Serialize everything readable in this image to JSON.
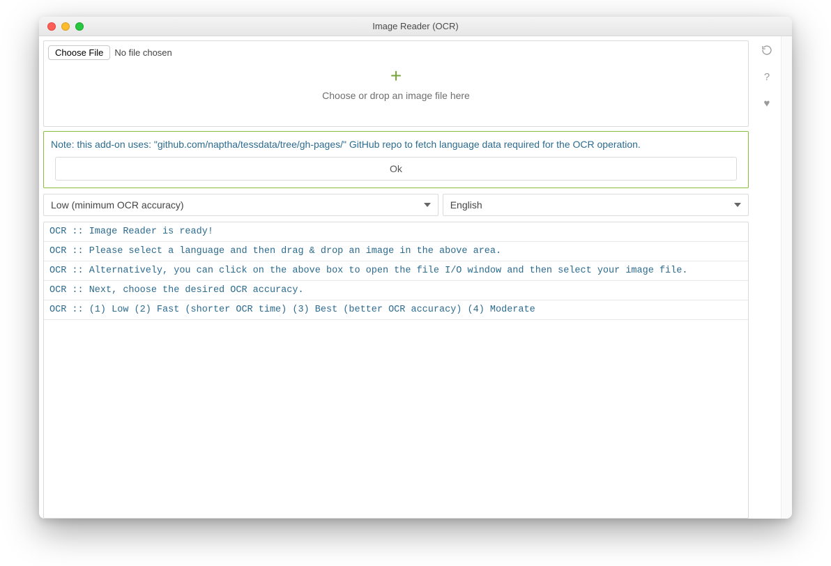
{
  "window": {
    "title": "Image Reader (OCR)"
  },
  "file": {
    "choose_label": "Choose File",
    "status": "No file chosen"
  },
  "dropzone": {
    "plus": "+",
    "prompt": "Choose or drop an image file here"
  },
  "note": {
    "text": "Note: this add-on uses: \"github.com/naptha/tessdata/tree/gh-pages/\" GitHub repo to fetch language data required for the OCR operation.",
    "ok": "Ok"
  },
  "selects": {
    "accuracy": "Low (minimum OCR accuracy)",
    "language": "English"
  },
  "log": [
    "OCR :: Image Reader is ready!",
    "OCR :: Please select a language and then drag & drop an image in the above area.",
    "OCR :: Alternatively, you can click on the above box to open the file I/O window and then select your image file.",
    "OCR :: Next, choose the desired OCR accuracy.",
    "OCR :: (1) Low (2) Fast (shorter OCR time) (3) Best (better OCR accuracy) (4) Moderate"
  ],
  "sidebar": {
    "reload": "↻",
    "help": "?",
    "heart": "♥"
  }
}
